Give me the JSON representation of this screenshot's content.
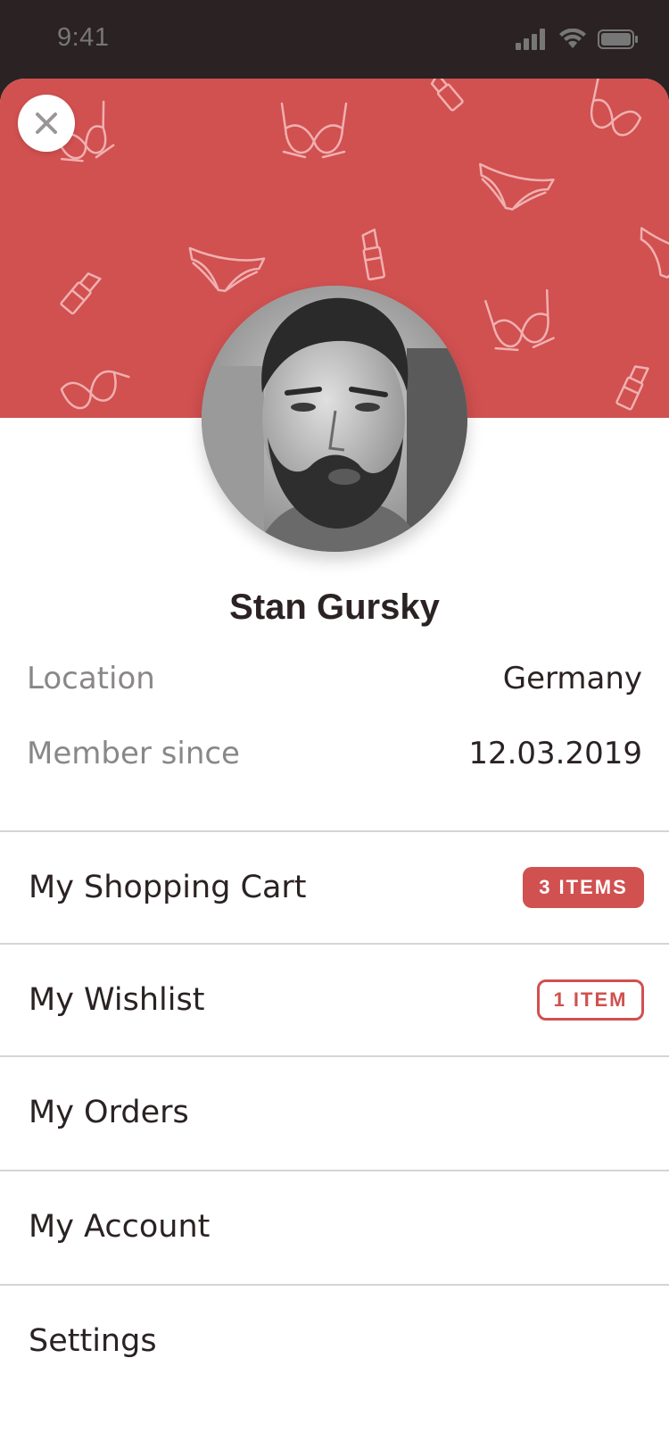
{
  "status_bar": {
    "time": "9:41",
    "icons": [
      "cellular-signal-icon",
      "wifi-icon",
      "battery-icon"
    ]
  },
  "profile": {
    "name": "Stan Gursky",
    "close_icon": "close-icon",
    "banner_pattern_icons": [
      "bra-icon",
      "panties-icon",
      "lipstick-icon"
    ],
    "info": [
      {
        "label": "Location",
        "value": "Germany"
      },
      {
        "label": "Member since",
        "value": "12.03.2019"
      }
    ]
  },
  "menu": {
    "items": [
      {
        "label": "My Shopping Cart",
        "badge": "3 ITEMS",
        "badge_style": "filled"
      },
      {
        "label": "My Wishlist",
        "badge": "1 ITEM",
        "badge_style": "outline"
      },
      {
        "label": "My Orders"
      },
      {
        "label": "My Account"
      },
      {
        "label": "Settings"
      }
    ]
  },
  "colors": {
    "accent": "#d15050",
    "status_bar_bg": "#2b2223",
    "text_primary": "#2b2223",
    "text_secondary": "#8a8787",
    "divider": "#d6d4d4"
  }
}
